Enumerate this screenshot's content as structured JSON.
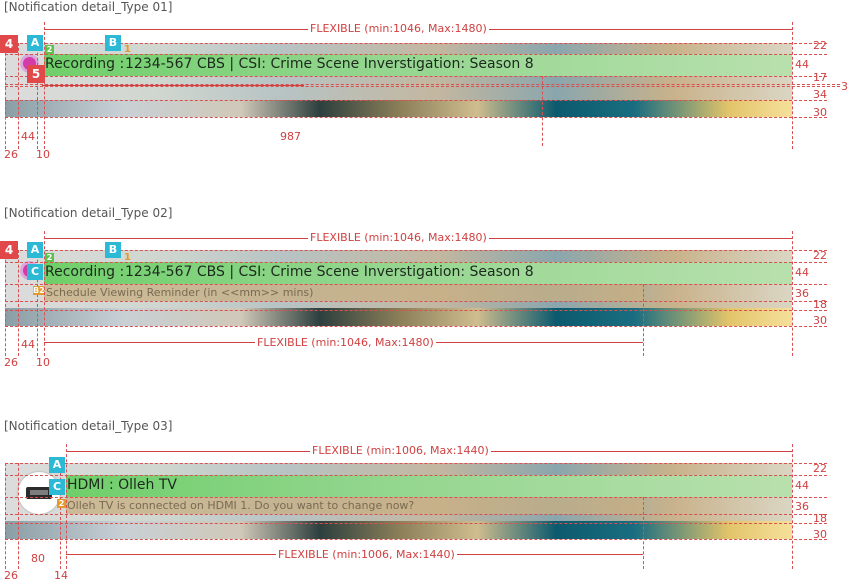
{
  "sections": [
    {
      "title": "[Notification detail_Type 01]",
      "flexible_label": "FLEXIBLE  (min:1046,  Max:1480)",
      "recording_label": "Recording :",
      "program_text": "1234-567 CBS | CSI: Crime Scene Inverstigation: Season 8",
      "badges": {
        "red_top": "4",
        "red_bottom": "5",
        "cyan_a": "A",
        "cyan_b": "B"
      },
      "tiny": {
        "green": "2",
        "orange": "1"
      },
      "right_dims": [
        "22",
        "44",
        "17",
        "3",
        "34",
        "30"
      ],
      "bottom_dims": [
        "26",
        "44",
        "10"
      ],
      "mid_dim": "987"
    },
    {
      "title": "[Notification detail_Type 02]",
      "flexible_label": "FLEXIBLE  (min:1046,  Max:1480)",
      "flexible_label_bottom": "FLEXIBLE  (min:1046,  Max:1480)",
      "recording_label": "Recording :",
      "program_text": "1234-567 CBS | CSI: Crime Scene Inverstigation: Season 8",
      "sub_text": "Schedule Viewing Reminder (in <<mm>> mins)",
      "badges": {
        "red_top": "4",
        "cyan_a": "A",
        "cyan_b": "B",
        "cyan_c": "C"
      },
      "tiny": {
        "green": "2",
        "orange": "1",
        "b2": "B2"
      },
      "right_dims": [
        "22",
        "44",
        "36",
        "18",
        "30"
      ],
      "bottom_dims": [
        "26",
        "44",
        "10"
      ]
    },
    {
      "title": "[Notification detail_Type 03]",
      "flexible_label": "FLEXIBLE  (min:1006,  Max:1440)",
      "flexible_label_bottom": "FLEXIBLE  (min:1006,  Max:1440)",
      "hdmi_text": "HDMI : Olleh TV",
      "sub_text": "Olleh TV is connected on HDMI 1. Do you want to change now?",
      "badges": {
        "cyan_a": "A",
        "cyan_c": "C"
      },
      "tiny": {
        "orange": "2"
      },
      "right_dims": [
        "22",
        "44",
        "36",
        "18",
        "30"
      ],
      "bottom_dims": [
        "26",
        "80",
        "14"
      ]
    }
  ],
  "colors": {
    "dim_red": "#d04040",
    "badge_red": "#e0484a",
    "badge_cyan": "#2cb9d6",
    "bar_green": "#6fcf6a"
  }
}
